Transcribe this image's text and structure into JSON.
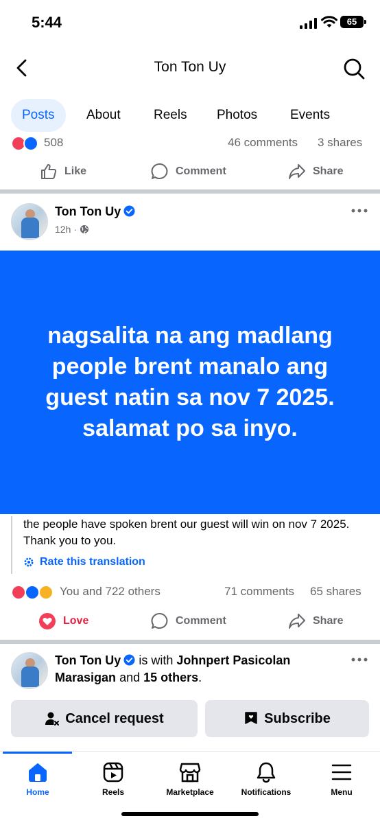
{
  "status_bar": {
    "time": "5:44",
    "battery": "65"
  },
  "header": {
    "title": "Ton Ton Uy",
    "back_icon": "chevron-left-icon",
    "search_icon": "search-icon"
  },
  "tabs": [
    {
      "label": "Posts",
      "active": true
    },
    {
      "label": "About",
      "active": false
    },
    {
      "label": "Reels",
      "active": false
    },
    {
      "label": "Photos",
      "active": false
    },
    {
      "label": "Events",
      "active": false
    }
  ],
  "prev_post": {
    "reaction_count": "508",
    "comments": "46 comments",
    "shares": "3 shares",
    "actions": {
      "like": "Like",
      "comment": "Comment",
      "share": "Share"
    }
  },
  "post": {
    "author": "Ton Ton Uy",
    "time": "12h",
    "privacy_sep": "·",
    "text_card": "nagsalita na ang madlang people brent manalo ang guest natin sa nov 7 2025. salamat po sa inyo.",
    "translation": "the people have spoken brent our guest will win on nov 7 2025. Thank you to you.",
    "rate_translation": "Rate this translation",
    "reactions_text": "You and 722 others",
    "comments": "71 comments",
    "shares": "65 shares",
    "actions": {
      "love": "Love",
      "comment": "Comment",
      "share": "Share"
    },
    "colors": {
      "card_bg": "#0866ff",
      "love": "#e41e3f"
    }
  },
  "next_post": {
    "author": "Ton Ton Uy",
    "with_prefix": "is with",
    "tagged": "Johnpert Pasicolan Marasigan",
    "and": "and",
    "others": "15 others",
    "period": "."
  },
  "buttons": {
    "cancel_request": "Cancel request",
    "subscribe": "Subscribe"
  },
  "tab_bar": [
    {
      "label": "Home",
      "icon": "home-icon",
      "active": true
    },
    {
      "label": "Reels",
      "icon": "reels-icon",
      "active": false
    },
    {
      "label": "Marketplace",
      "icon": "marketplace-icon",
      "active": false
    },
    {
      "label": "Notifications",
      "icon": "bell-icon",
      "active": false
    },
    {
      "label": "Menu",
      "icon": "menu-icon",
      "active": false
    }
  ],
  "accent_color": "#0866ff"
}
